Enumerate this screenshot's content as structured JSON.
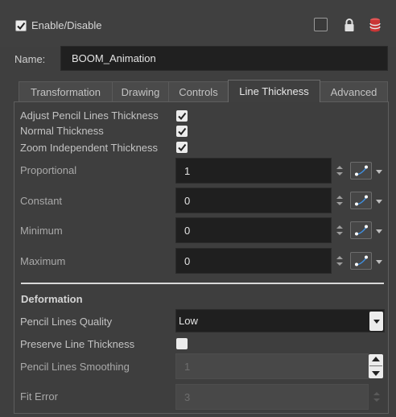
{
  "header": {
    "enable_label": "Enable/Disable",
    "enable_checked": true
  },
  "name": {
    "label": "Name:",
    "value": "BOOM_Animation"
  },
  "tabs": [
    {
      "label": "Transformation",
      "active": false
    },
    {
      "label": "Drawing",
      "active": false
    },
    {
      "label": "Controls",
      "active": false
    },
    {
      "label": "Line Thickness",
      "active": true
    },
    {
      "label": "Advanced",
      "active": false
    }
  ],
  "line_thickness": {
    "adjust_pencil": {
      "label": "Adjust Pencil Lines Thickness",
      "checked": true
    },
    "normal_thickness": {
      "label": "Normal Thickness",
      "checked": true
    },
    "zoom_independent": {
      "label": "Zoom Independent Thickness",
      "checked": true
    },
    "proportional": {
      "label": "Proportional",
      "value": "1"
    },
    "constant": {
      "label": "Constant",
      "value": "0"
    },
    "minimum": {
      "label": "Minimum",
      "value": "0"
    },
    "maximum": {
      "label": "Maximum",
      "value": "0"
    }
  },
  "deformation": {
    "title": "Deformation",
    "quality": {
      "label": "Pencil Lines Quality",
      "value": "Low"
    },
    "preserve": {
      "label": "Preserve Line Thickness",
      "checked": false
    },
    "smoothing": {
      "label": "Pencil Lines Smoothing",
      "value": "1"
    },
    "fit_error": {
      "label": "Fit Error",
      "value": "3"
    }
  },
  "icons": {
    "enable_check": "check-icon",
    "square_button": "square-icon",
    "lock": "lock-icon",
    "database": "database-icon",
    "function_curve": "function-curve-icon"
  },
  "colors": {
    "background": "#3f3f3f",
    "field": "#1f1f1f",
    "accent_blue": "#3f8fe0",
    "db_red": "#d23a3a"
  }
}
